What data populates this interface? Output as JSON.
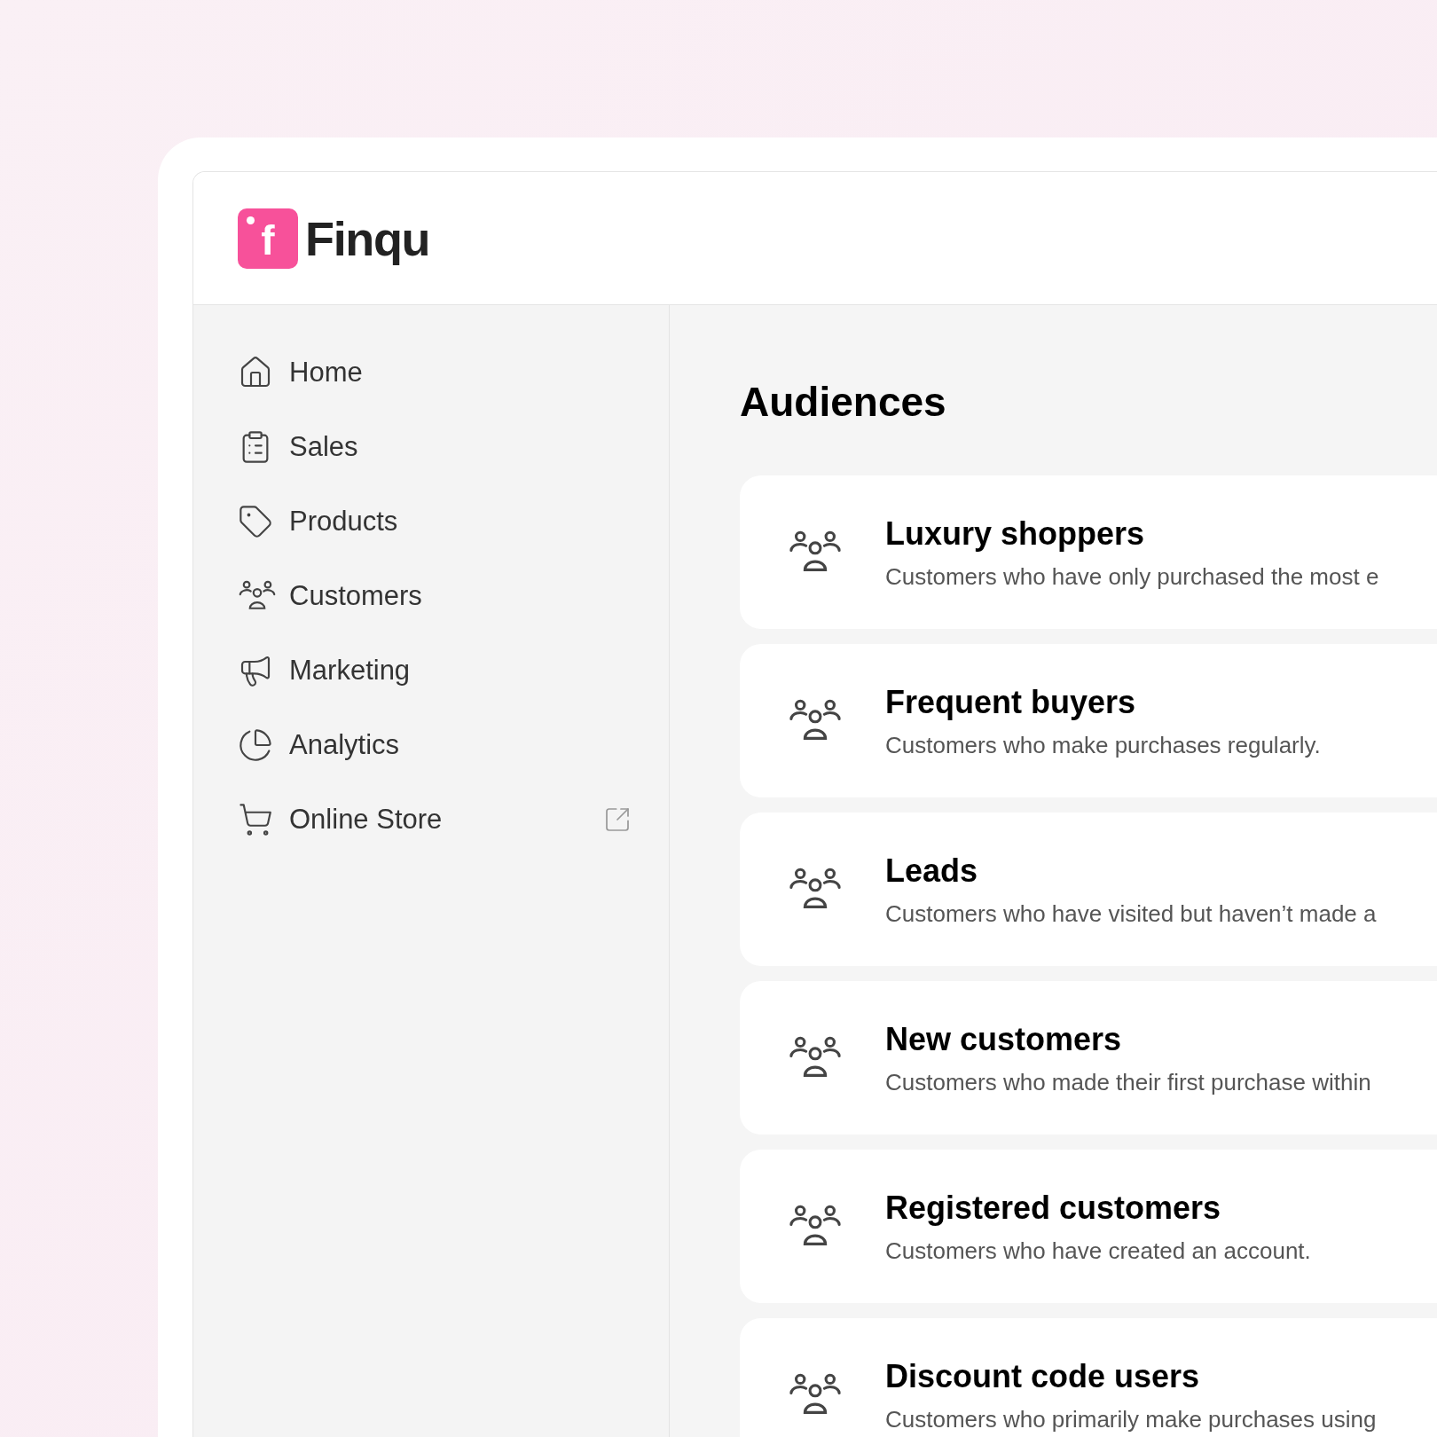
{
  "logo": {
    "mark": "f",
    "name": "Finqu"
  },
  "sidebar": {
    "items": [
      {
        "label": "Home",
        "kind": "home",
        "external": false
      },
      {
        "label": "Sales",
        "kind": "sales",
        "external": false
      },
      {
        "label": "Products",
        "kind": "products",
        "external": false
      },
      {
        "label": "Customers",
        "kind": "customers",
        "external": false
      },
      {
        "label": "Marketing",
        "kind": "marketing",
        "external": false
      },
      {
        "label": "Analytics",
        "kind": "analytics",
        "external": false
      },
      {
        "label": "Online Store",
        "kind": "store",
        "external": true
      }
    ]
  },
  "page": {
    "title": "Audiences"
  },
  "audiences": [
    {
      "name": "Luxury shoppers",
      "description": "Customers who have only purchased the most e"
    },
    {
      "name": "Frequent buyers",
      "description": "Customers who make purchases regularly."
    },
    {
      "name": "Leads",
      "description": "Customers who have visited but haven’t made a"
    },
    {
      "name": "New customers",
      "description": "Customers who made their first purchase within"
    },
    {
      "name": "Registered customers",
      "description": "Customers who have created an account."
    },
    {
      "name": "Discount code users",
      "description": "Customers who primarily make purchases using"
    }
  ]
}
